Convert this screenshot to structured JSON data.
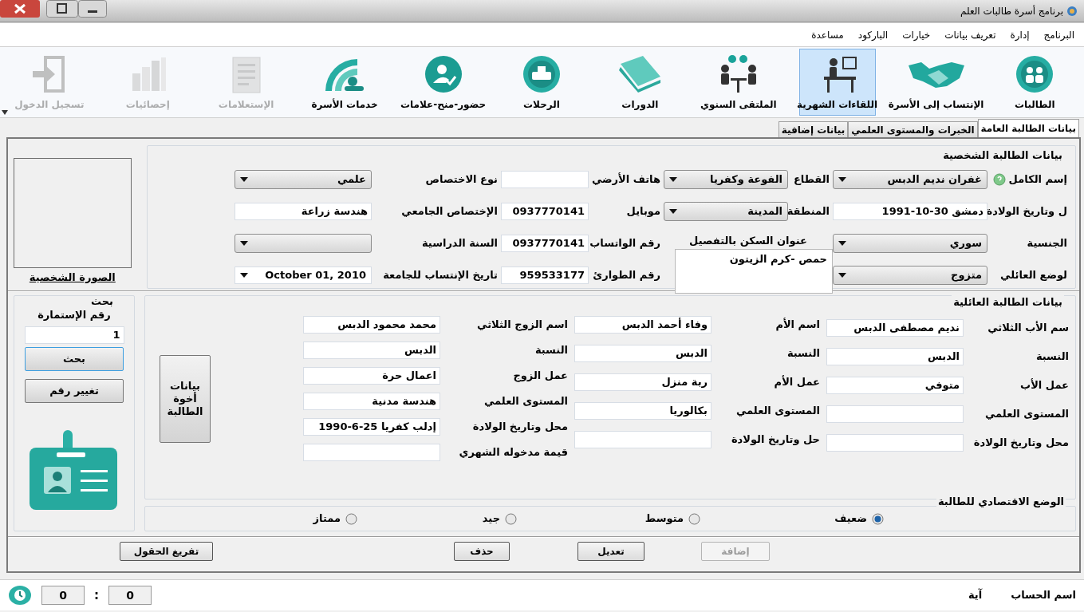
{
  "window": {
    "title": "برنامج أسرة طالبات العلم"
  },
  "menu": [
    "البرنامج",
    "إدارة",
    "تعريف بيانات",
    "خيارات",
    "الباركود",
    "مساعدة"
  ],
  "toolbar": [
    {
      "label": "الطالبات",
      "selected": false,
      "disabled": false
    },
    {
      "label": "الإنتساب إلى الأسرة",
      "selected": false,
      "disabled": false
    },
    {
      "label": "اللقاءات الشهرية",
      "selected": true,
      "disabled": false
    },
    {
      "label": "الملتقى السنوي",
      "selected": false,
      "disabled": false
    },
    {
      "label": "الدورات",
      "selected": false,
      "disabled": false
    },
    {
      "label": "الرحلات",
      "selected": false,
      "disabled": false
    },
    {
      "label": "حضور-منح-علامات",
      "selected": false,
      "disabled": false
    },
    {
      "label": "خدمات الأسرة",
      "selected": false,
      "disabled": false
    },
    {
      "label": "الإستعلامات",
      "selected": false,
      "disabled": true
    },
    {
      "label": "إحصائيات",
      "selected": false,
      "disabled": true
    },
    {
      "label": "تسجيل الدخول",
      "selected": false,
      "disabled": true
    }
  ],
  "tabs": [
    {
      "label": "بيانات الطالبة العامة",
      "selected": true
    },
    {
      "label": "الخبرات والمستوى العلمي",
      "selected": false
    },
    {
      "label": "بيانات إضافية",
      "selected": false
    }
  ],
  "personal": {
    "title": "بيانات الطالبة الشخصية",
    "columns": [
      [
        {
          "label": "إسم الكامل",
          "value": "غفران نديم الدبس",
          "kind": "combo"
        },
        {
          "label": "ل وتاريخ الولادة",
          "value": "دمشق 30-10-1991",
          "kind": "text"
        },
        {
          "label": "الجنسية",
          "value": "سوري",
          "kind": "combo"
        },
        {
          "label": "لوضع العائلي",
          "value": "متزوج",
          "kind": "combo"
        }
      ],
      [
        {
          "label": "القطاع",
          "value": "الفوعة وكفريا",
          "kind": "combo"
        },
        {
          "label": "المنطقة",
          "value": "المدينة",
          "kind": "combo"
        },
        {
          "label": "عنوان السكن بالتفصيل",
          "value": "حمص -كرم الزيتون",
          "kind": "textarea"
        }
      ],
      [
        {
          "label": "هاتف الأرضي",
          "kind": "text"
        },
        {
          "label": "موبايل",
          "value": "0937770141",
          "kind": "text"
        },
        {
          "label": "رقم الواتساب",
          "value": "0937770141",
          "kind": "text"
        },
        {
          "label": "رقم الطوارئ",
          "value": "959533177",
          "kind": "text"
        }
      ],
      [
        {
          "label": "نوع الاختصاص",
          "value": "علمي",
          "kind": "combo"
        },
        {
          "label": "الإختصاص الجامعي",
          "value": "هندسة زراعة",
          "kind": "text"
        },
        {
          "label": "السنة الدراسية",
          "kind": "combo"
        },
        {
          "label": "تاريخ الإنتساب للجامعة",
          "value": "October 01, 2010",
          "kind": "date"
        }
      ]
    ],
    "photo_label": "الصورة الشخصية"
  },
  "family": {
    "title": "بيانات الطالبة العائلية",
    "columns": [
      [
        {
          "label": "سم الأب الثلاثي",
          "value": "نديم مصطفى الدبس"
        },
        {
          "label": "النسبة",
          "value": "الدبس"
        },
        {
          "label": "عمل الأب",
          "value": "متوفي"
        },
        {
          "label": "المستوى العلمي"
        },
        {
          "label": "محل وتاريخ الولادة"
        }
      ],
      [
        {
          "label": "اسم الأم",
          "value": "وفاء أحمد الدبس"
        },
        {
          "label": "النسبة",
          "value": "الدبس"
        },
        {
          "label": "عمل الأم",
          "value": "ربة منزل"
        },
        {
          "label": "المستوى العلمي",
          "value": "بكالوريا"
        },
        {
          "label": "حل وتاريخ الولادة"
        }
      ],
      [
        {
          "label": "اسم الزوج الثلاثي",
          "value": "محمد محمود الدبس"
        },
        {
          "label": "النسبة",
          "value": "الدبس"
        },
        {
          "label": "عمل الزوج",
          "value": "اعمال حرة"
        },
        {
          "label": "المستوى العلمي",
          "value": "هندسة مدنية"
        },
        {
          "label": "محل وتاريخ الولادة",
          "value": "إدلب كفريا 25-6-1990"
        },
        {
          "label": "قيمة مدخوله الشهري"
        }
      ]
    ],
    "siblings_button": "بيانات أخوة الطالبة"
  },
  "search": {
    "title": "بحث",
    "label": "رقم الإستمارة",
    "value": "1",
    "buttons": [
      "بحث",
      "تغيير رقم"
    ]
  },
  "economic": {
    "title": "الوضع الاقتصادي للطالبة",
    "options": [
      {
        "label": "ضعيف",
        "selected": true
      },
      {
        "label": "متوسط",
        "selected": false
      },
      {
        "label": "جيد",
        "selected": false
      },
      {
        "label": "ممتاز",
        "selected": false
      }
    ]
  },
  "actions": [
    {
      "label": "إضافة",
      "disabled": true
    },
    {
      "label": "تعديل",
      "disabled": false
    },
    {
      "label": "حذف",
      "disabled": false
    },
    {
      "label": "تفريغ الحقول",
      "disabled": false
    }
  ],
  "status_bar": {
    "account_label": "اسم الحساب",
    "account_name": "آية",
    "counter": [
      "0",
      ":",
      "0"
    ]
  }
}
